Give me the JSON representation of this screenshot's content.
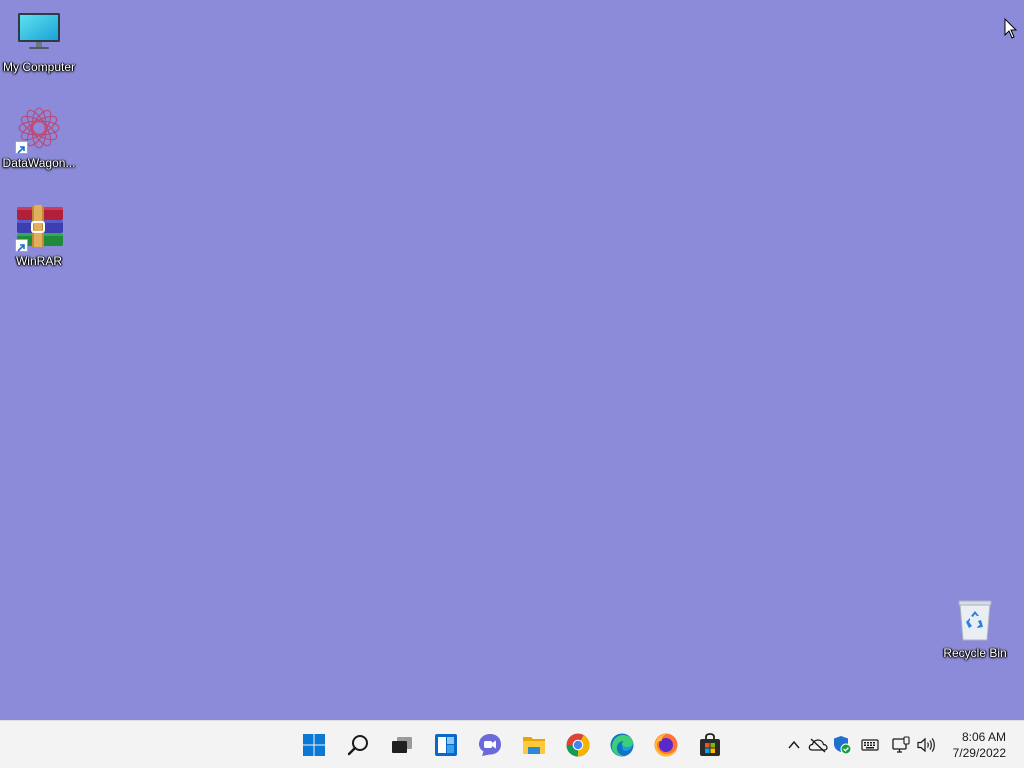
{
  "desktop": {
    "background_color": "#8c8bd9",
    "icons": [
      {
        "label": "My Computer",
        "icon": "monitor-icon"
      },
      {
        "label": "DataWagon...",
        "icon": "datawagon-icon",
        "shortcut": true
      },
      {
        "label": "WinRAR",
        "icon": "winrar-icon",
        "shortcut": true
      },
      {
        "label": "Recycle Bin",
        "icon": "recycle-bin-icon"
      }
    ]
  },
  "taskbar": {
    "background_color": "#f3f3f3",
    "apps": [
      {
        "name": "Start",
        "icon": "windows-start-icon"
      },
      {
        "name": "Search",
        "icon": "search-icon"
      },
      {
        "name": "Task View",
        "icon": "task-view-icon"
      },
      {
        "name": "Widgets",
        "icon": "widgets-icon"
      },
      {
        "name": "Chat",
        "icon": "teams-chat-icon"
      },
      {
        "name": "File Explorer",
        "icon": "file-explorer-icon"
      },
      {
        "name": "Google Chrome",
        "icon": "chrome-icon"
      },
      {
        "name": "Microsoft Edge",
        "icon": "edge-icon"
      },
      {
        "name": "Firefox",
        "icon": "firefox-icon"
      },
      {
        "name": "Microsoft Store",
        "icon": "store-icon"
      }
    ],
    "tray": {
      "icons": [
        "chevron-up-icon",
        "onedrive-offline-icon",
        "defender-icon",
        "keyboard-icon",
        "network-icon",
        "volume-icon"
      ],
      "time": "8:06 AM",
      "date": "7/29/2022"
    }
  }
}
